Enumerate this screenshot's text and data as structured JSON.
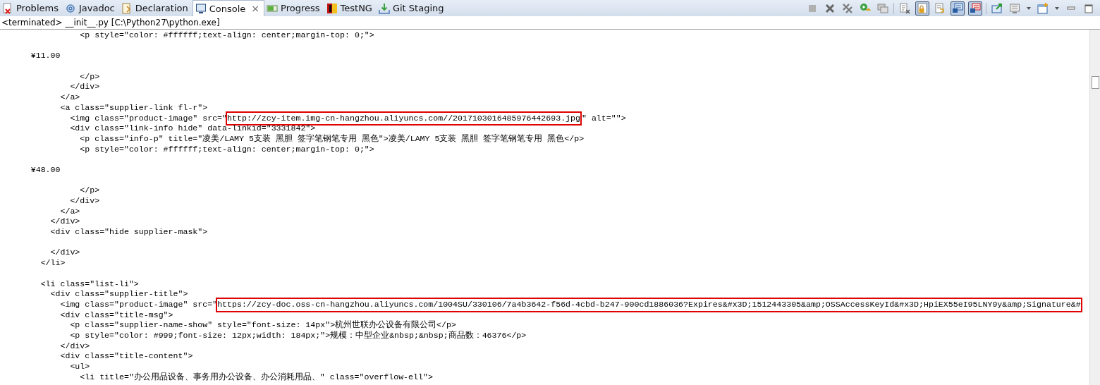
{
  "tabs": [
    {
      "label": "Problems",
      "kind": "problems",
      "selected": false
    },
    {
      "label": "Javadoc",
      "kind": "javadoc",
      "selected": false
    },
    {
      "label": "Declaration",
      "kind": "declaration",
      "selected": false
    },
    {
      "label": "Console",
      "kind": "console",
      "selected": true,
      "close": "×"
    },
    {
      "label": "Progress",
      "kind": "progress",
      "selected": false
    },
    {
      "label": "TestNG",
      "kind": "testng",
      "selected": false
    },
    {
      "label": "Git Staging",
      "kind": "git",
      "selected": false
    }
  ],
  "toolbar": [
    {
      "kind": "stop",
      "pressed": false
    },
    {
      "kind": "remove",
      "pressed": false
    },
    {
      "kind": "removeall",
      "pressed": false
    },
    {
      "kind": "run",
      "pressed": false
    },
    {
      "kind": "stack",
      "pressed": false
    },
    {
      "kind": "sep"
    },
    {
      "kind": "clear",
      "pressed": false
    },
    {
      "kind": "lock",
      "pressed": true
    },
    {
      "kind": "wrap",
      "pressed": false
    },
    {
      "kind": "stdout",
      "pressed": true
    },
    {
      "kind": "stderr",
      "pressed": true
    },
    {
      "kind": "sep"
    },
    {
      "kind": "pin",
      "pressed": false
    },
    {
      "kind": "monitor",
      "pressed": false
    },
    {
      "kind": "caret",
      "pressed": false
    },
    {
      "kind": "new",
      "pressed": false
    },
    {
      "kind": "caret",
      "pressed": false
    },
    {
      "kind": "minimize",
      "pressed": false
    },
    {
      "kind": "maximize",
      "pressed": false
    }
  ],
  "status": "<terminated> __init__.py [C:\\Python27\\python.exe]",
  "lines": [
    {
      "kind": "code",
      "code": "                <p style=\"color: #ffffff;text-align: center;margin-top: 0;\">"
    },
    {
      "kind": "blank"
    },
    {
      "kind": "code",
      "code": "      ¥11.00"
    },
    {
      "kind": "blank"
    },
    {
      "kind": "code",
      "code": "                </p>"
    },
    {
      "kind": "code",
      "code": "              </div>"
    },
    {
      "kind": "code",
      "code": "            </a>"
    },
    {
      "kind": "code",
      "code": "            <a class=\"supplier-link fl-r\">"
    },
    {
      "kind": "marked",
      "code": "              <img class=\"product-image\" src=\"",
      "highlight": "http://zcy-item.img-cn-hangzhou.aliyuncs.com//2017103016485976442693.jpg",
      "rest": "\" alt=\"\">"
    },
    {
      "kind": "code",
      "code": "              <div class=\"link-info hide\" data-linkid=\"3331842\">"
    },
    {
      "kind": "code",
      "code": "                <p class=\"info-p\" title=\"凌美/LAMY 5支装 黑胆 签字笔钢笔专用 黑色\">凌美/LAMY 5支装 黑胆 签字笔钢笔专用 黑色</p>"
    },
    {
      "kind": "code",
      "code": "                <p style=\"color: #ffffff;text-align: center;margin-top: 0;\">"
    },
    {
      "kind": "blank"
    },
    {
      "kind": "code",
      "code": "      ¥48.00"
    },
    {
      "kind": "blank"
    },
    {
      "kind": "code",
      "code": "                </p>"
    },
    {
      "kind": "code",
      "code": "              </div>"
    },
    {
      "kind": "code",
      "code": "            </a>"
    },
    {
      "kind": "code",
      "code": "          </div>"
    },
    {
      "kind": "code",
      "code": "          <div class=\"hide supplier-mask\">"
    },
    {
      "kind": "blank"
    },
    {
      "kind": "code",
      "code": "          </div>"
    },
    {
      "kind": "code",
      "code": "        </li>"
    },
    {
      "kind": "blank"
    },
    {
      "kind": "code",
      "code": "        <li class=\"list-li\">"
    },
    {
      "kind": "code",
      "code": "          <div class=\"supplier-title\">"
    },
    {
      "kind": "marked",
      "code": "            <img class=\"product-image\" src=\"",
      "highlight": "https://zcy-doc.oss-cn-hangzhou.aliyuncs.com/1004SU/330106/7a4b3642-f56d-4cbd-b247-900cd1886036?Expires&#x3D;1512443305&amp;OSSAccessKeyId&#x3D;HpiEX55eI95LNY9y&amp;Signature&#"
    },
    {
      "kind": "code",
      "code": "            <div class=\"title-msg\">"
    },
    {
      "kind": "code",
      "code": "              <p class=\"supplier-name-show\" style=\"font-size: 14px\">杭州世联办公设备有限公司</p>"
    },
    {
      "kind": "code",
      "code": "              <p style=\"color: #999;font-size: 12px;width: 184px;\">规模：中型企业&nbsp;&nbsp;商品数：46376</p>"
    },
    {
      "kind": "code",
      "code": "            </div>"
    },
    {
      "kind": "code",
      "code": "            <div class=\"title-content\">"
    },
    {
      "kind": "code",
      "code": "              <ul>"
    },
    {
      "kind": "code",
      "code": "                <li title=\"办公用品设备、事务用办公设备、办公消耗用品、\" class=\"overflow-ell\">"
    }
  ]
}
